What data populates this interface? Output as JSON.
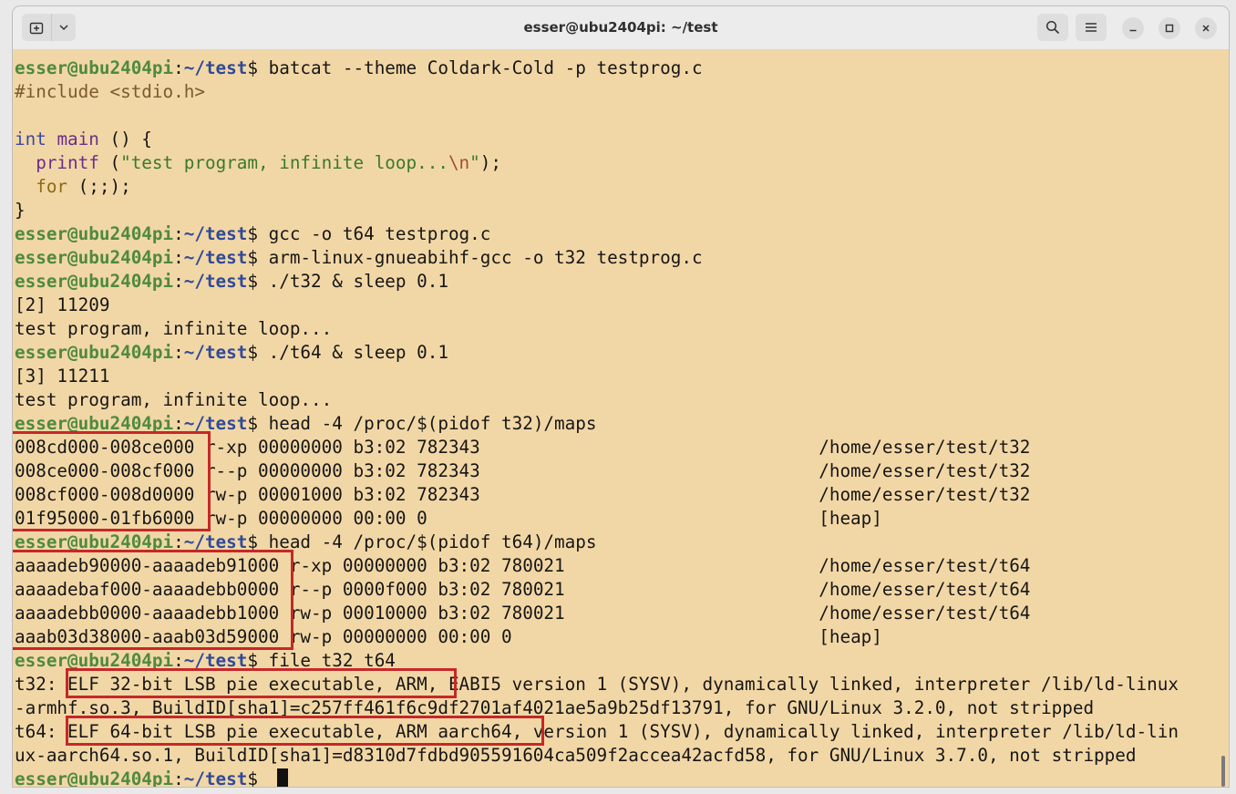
{
  "window": {
    "title": "esser@ubu2404pi: ~/test",
    "icons": {
      "new_tab": "new-tab-icon",
      "dropdown": "chevron-down-icon",
      "search": "search-icon",
      "menu": "hamburger-menu-icon",
      "minimize": "minimize-icon",
      "maximize": "maximize-icon",
      "close": "close-icon"
    }
  },
  "colors": {
    "background": "#f2d7a6",
    "prompt_user": "#4e8a3f",
    "prompt_path": "#2f4a99",
    "highlight_box": "#c62828"
  },
  "prompt": {
    "user_host": "esser@ubu2404pi",
    "colon": ":",
    "path": "~/test",
    "dollar": "$ "
  },
  "commands": {
    "c1": "batcat --theme Coldark-Cold -p testprog.c",
    "c2": "gcc -o t64 testprog.c",
    "c3": "arm-linux-gnueabihf-gcc -o t32 testprog.c",
    "c4": "./t32 & sleep 0.1",
    "c5": "./t64 & sleep 0.1",
    "c6": "head -4 /proc/$(pidof t32)/maps",
    "c7": "head -4 /proc/$(pidof t64)/maps",
    "c8": "file t32 t64"
  },
  "source": {
    "include": "#include <stdio.h>",
    "int_kw": "int",
    "main_fn": "main",
    "main_rest": " () {",
    "printf_indent": "  ",
    "printf_fn": "printf",
    "printf_paren": " (",
    "printf_str1": "\"test program, infinite loop...",
    "printf_esc": "\\n",
    "printf_str2": "\"",
    "printf_end": ");",
    "for_indent": "  ",
    "for_kw": "for",
    "for_rest": " (;;);",
    "close_brace": "}"
  },
  "outputs": {
    "job2": "[2] 11209",
    "run1": "test program, infinite loop...",
    "job3": "[3] 11211",
    "run2": "test program, infinite loop..."
  },
  "maps_t32": [
    {
      "addr": "008cd000-008ce000",
      "rest": " r-xp 00000000 b3:02 782343                                /home/esser/test/t32"
    },
    {
      "addr": "008ce000-008cf000",
      "rest": " r--p 00000000 b3:02 782343                                /home/esser/test/t32"
    },
    {
      "addr": "008cf000-008d0000",
      "rest": " rw-p 00001000 b3:02 782343                                /home/esser/test/t32"
    },
    {
      "addr": "01f95000-01fb6000",
      "rest": " rw-p 00000000 00:00 0                                     [heap]"
    }
  ],
  "maps_t64": [
    {
      "addr": "aaaadeb90000-aaaadeb91000",
      "rest": " r-xp 00000000 b3:02 780021                        /home/esser/test/t64"
    },
    {
      "addr": "aaaadebaf000-aaaadebb0000",
      "rest": " r--p 0000f000 b3:02 780021                        /home/esser/test/t64"
    },
    {
      "addr": "aaaadebb0000-aaaadebb1000",
      "rest": " rw-p 00010000 b3:02 780021                        /home/esser/test/t64"
    },
    {
      "addr": "aaab03d38000-aaab03d59000",
      "rest": " rw-p 00000000 00:00 0                             [heap]"
    }
  ],
  "file_output": {
    "t32_prefix": "t32: ",
    "t32_highlight": "ELF 32-bit LSB pie executable, ARM,",
    "t32_rest": " EABI5 version 1 (SYSV), dynamically linked, interpreter /lib/ld-linux",
    "t32_line2": "-armhf.so.3, BuildID[sha1]=c257ff461f6c9df2701af4021ae5a9b25df13791, for GNU/Linux 3.2.0, not stripped",
    "t64_prefix": "t64: ",
    "t64_highlight": "ELF 64-bit LSB pie executable, ARM aarch64,",
    "t64_rest": " version 1 (SYSV), dynamically linked, interpreter /lib/ld-lin",
    "t64_line2": "ux-aarch64.so.1, BuildID[sha1]=d8310d7fdbd905591604ca509f2accea42acfd58, for GNU/Linux 3.7.0, not stripped"
  }
}
